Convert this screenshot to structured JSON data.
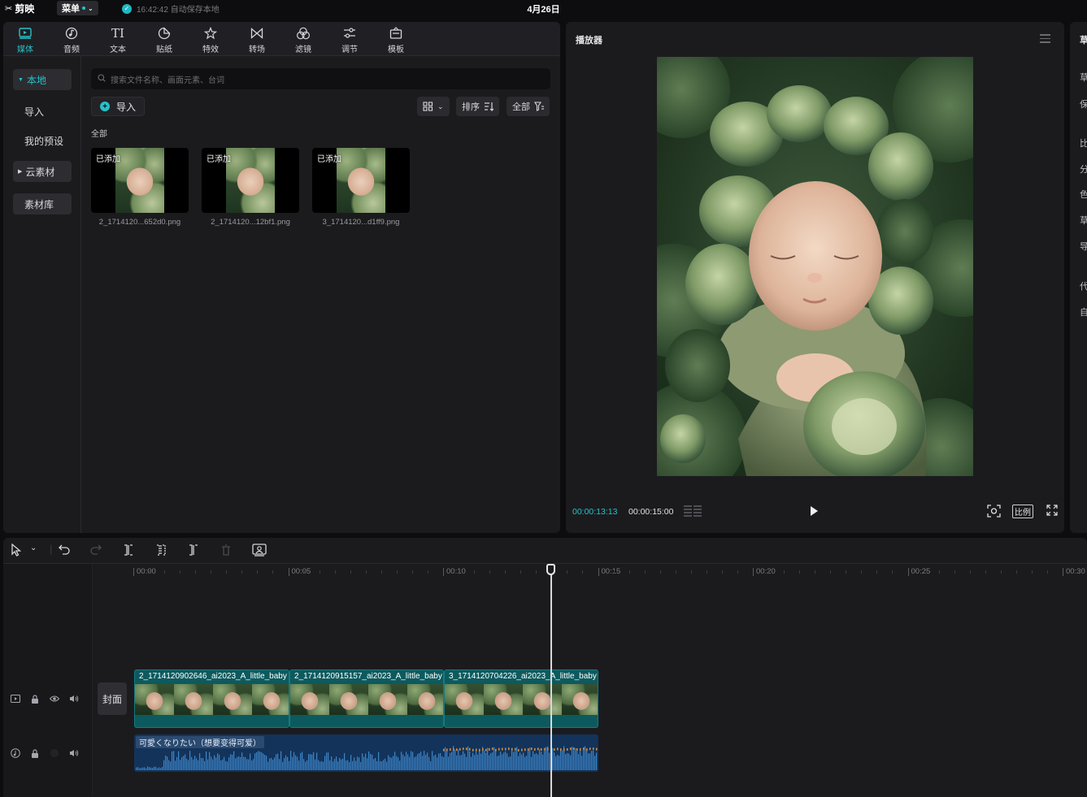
{
  "titlebar": {
    "app_name": "剪映",
    "menu_label": "菜单",
    "save_status": "16:42:42 自动保存本地",
    "date": "4月26日"
  },
  "toolbar": {
    "tools": [
      {
        "label": "媒体",
        "icon": "media-icon"
      },
      {
        "label": "音频",
        "icon": "audio-icon"
      },
      {
        "label": "文本",
        "icon": "text-icon"
      },
      {
        "label": "贴纸",
        "icon": "sticker-icon"
      },
      {
        "label": "特效",
        "icon": "effects-icon"
      },
      {
        "label": "转场",
        "icon": "transition-icon"
      },
      {
        "label": "滤镜",
        "icon": "filter-icon"
      },
      {
        "label": "调节",
        "icon": "adjust-icon"
      },
      {
        "label": "模板",
        "icon": "template-icon"
      }
    ],
    "text_glyph": "TI"
  },
  "sidenav": {
    "local": "本地",
    "import": "导入",
    "presets": "我的预设",
    "cloud": "云素材",
    "library": "素材库"
  },
  "media": {
    "search_placeholder": "搜索文件名称、画面元素、台词",
    "import_label": "导入",
    "sort_label": "排序",
    "filter_label": "全部",
    "section_all": "全部",
    "items": [
      {
        "badge": "已添加",
        "name": "2_1714120...652d0.png"
      },
      {
        "badge": "已添加",
        "name": "2_1714120...12bf1.png"
      },
      {
        "badge": "已添加",
        "name": "3_1714120...d1ff9.png"
      }
    ]
  },
  "player": {
    "title": "播放器",
    "current_time": "00:00:13:13",
    "total_time": "00:00:15:00",
    "ratio_label": "比例"
  },
  "right_panel_chars": [
    "草",
    "草",
    "保",
    "比",
    "分",
    "色",
    "草",
    "导",
    "代",
    "自"
  ],
  "timeline": {
    "ruler": [
      "00:00",
      "00:05",
      "00:10",
      "00:15",
      "00:20",
      "00:25",
      "00:30"
    ],
    "cover_label": "封面",
    "clips": [
      {
        "name": "2_1714120902646_ai2023_A_little_baby"
      },
      {
        "name": "2_1714120915157_ai2023_A_little_baby"
      },
      {
        "name": "3_1714120704226_ai2023_A_little_baby"
      }
    ],
    "audio_name": "可愛くなりたい（想要变得可爱）",
    "playhead_time": "00:00:13:13"
  },
  "colors": {
    "accent": "#26c2c9",
    "clip": "#0d5a5e",
    "audio": "#13335a"
  }
}
